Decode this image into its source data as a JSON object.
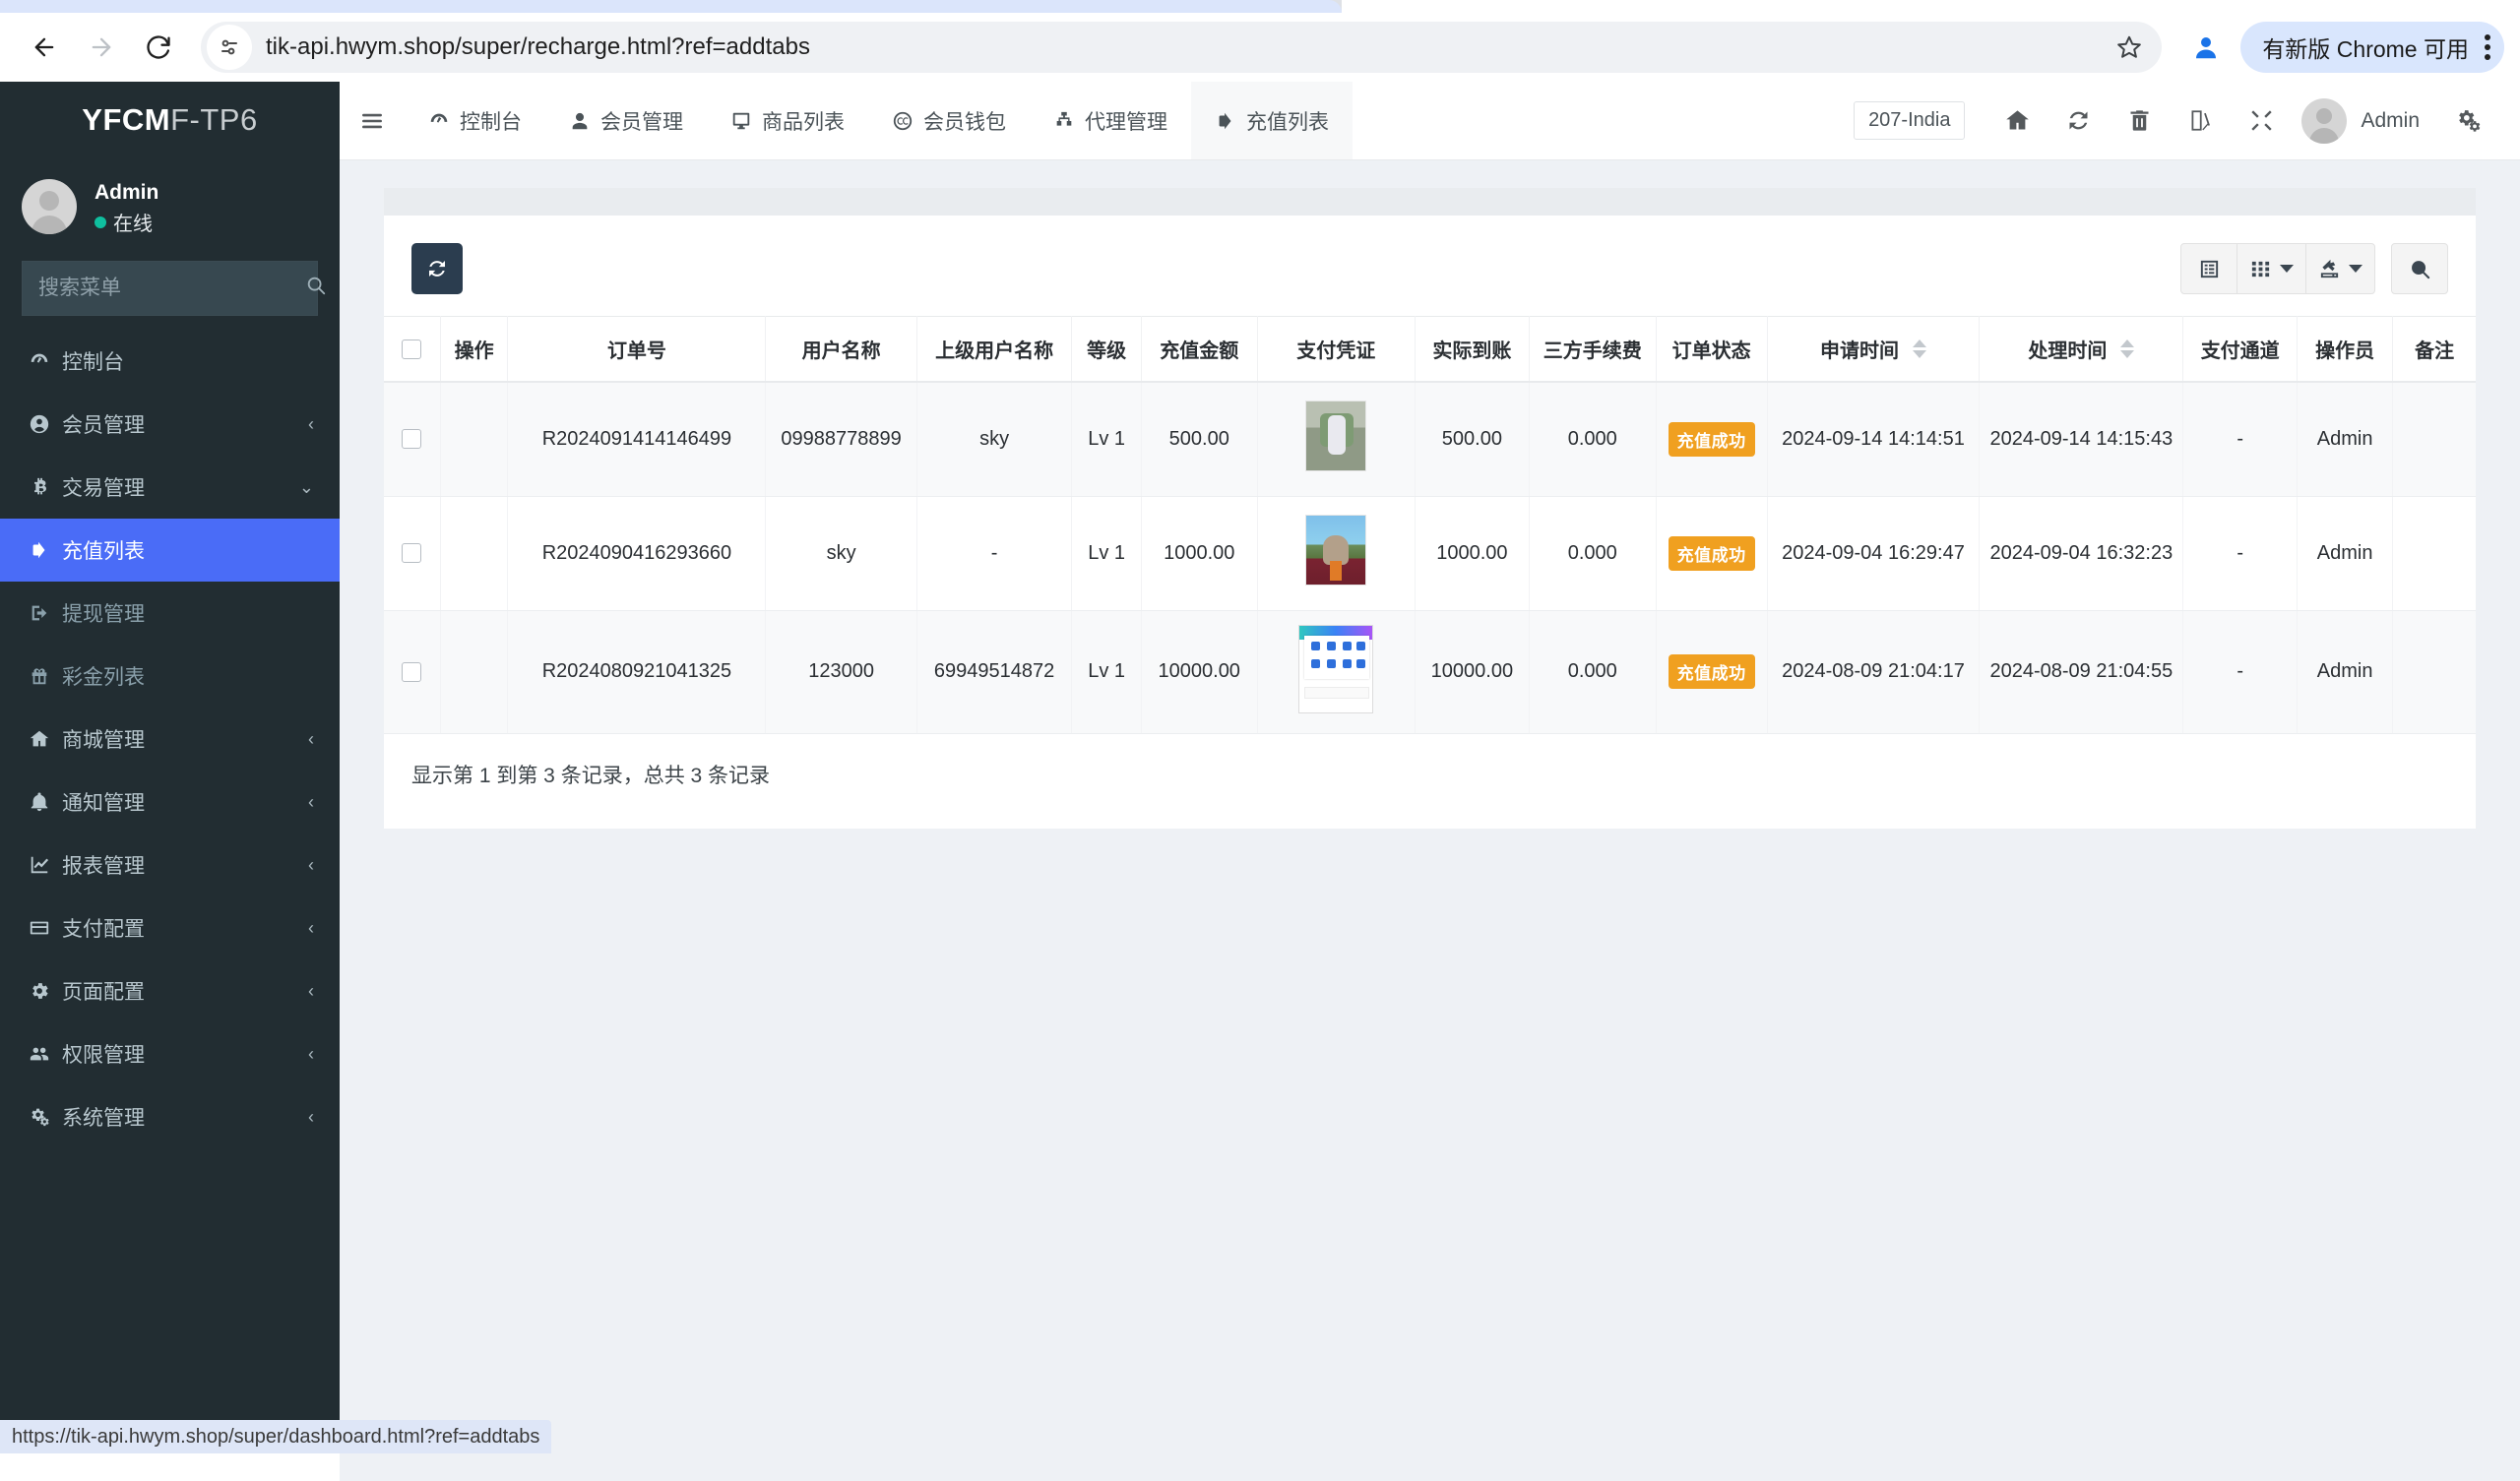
{
  "browser": {
    "url": "tik-api.hwym.shop/super/recharge.html?ref=addtabs",
    "back_icon": "back-arrow-icon",
    "forward_icon": "forward-arrow-icon",
    "reload_icon": "reload-icon",
    "site_info_icon": "site-settings-icon",
    "bookmark_icon": "star-icon",
    "profile_icon": "profile-avatar-icon",
    "update_label": "有新版 Chrome 可用",
    "menu_icon": "three-dot-menu-icon",
    "status_link": "https://tik-api.hwym.shop/super/dashboard.html?ref=addtabs"
  },
  "sidebar": {
    "brand_a": "YFCM",
    "brand_b": "F-TP6",
    "user": {
      "name": "Admin",
      "status": "在线"
    },
    "search_placeholder": "搜索菜单",
    "search_value": "",
    "search_icon": "search-icon",
    "items": [
      {
        "label": "控制台",
        "icon": "dashboard-icon",
        "caret": "",
        "state": "normal"
      },
      {
        "label": "会员管理",
        "icon": "user-circle-icon",
        "caret": "‹",
        "state": "normal"
      },
      {
        "label": "交易管理",
        "icon": "bitcoin-icon",
        "caret": "⌄",
        "state": "expanded"
      },
      {
        "label": "充值列表",
        "icon": "sign-in-icon",
        "caret": "",
        "state": "active"
      },
      {
        "label": "提现管理",
        "icon": "sign-out-icon",
        "caret": "",
        "state": "dim"
      },
      {
        "label": "彩金列表",
        "icon": "gift-icon",
        "caret": "",
        "state": "dim"
      },
      {
        "label": "商城管理",
        "icon": "home-icon",
        "caret": "‹",
        "state": "normal"
      },
      {
        "label": "通知管理",
        "icon": "bell-icon",
        "caret": "‹",
        "state": "normal"
      },
      {
        "label": "报表管理",
        "icon": "chart-line-icon",
        "caret": "‹",
        "state": "normal"
      },
      {
        "label": "支付配置",
        "icon": "credit-card-icon",
        "caret": "‹",
        "state": "normal"
      },
      {
        "label": "页面配置",
        "icon": "gear-icon",
        "caret": "‹",
        "state": "normal"
      },
      {
        "label": "权限管理",
        "icon": "users-icon",
        "caret": "‹",
        "state": "normal"
      },
      {
        "label": "系统管理",
        "icon": "gears-icon",
        "caret": "‹",
        "state": "normal"
      }
    ]
  },
  "topnav": {
    "hamburger_icon": "hamburger-menu-icon",
    "tabs": [
      {
        "label": "控制台",
        "icon": "dashboard-icon",
        "active": false
      },
      {
        "label": "会员管理",
        "icon": "user-icon",
        "active": false
      },
      {
        "label": "商品列表",
        "icon": "monitor-icon",
        "active": false
      },
      {
        "label": "会员钱包",
        "icon": "cc-icon",
        "active": false
      },
      {
        "label": "代理管理",
        "icon": "sitemap-icon",
        "active": false
      },
      {
        "label": "充值列表",
        "icon": "sign-in-icon",
        "active": true
      }
    ],
    "lang_badge": "207-India",
    "icons": [
      {
        "name": "home-icon"
      },
      {
        "name": "refresh-icon"
      },
      {
        "name": "trash-icon"
      },
      {
        "name": "language-switch-icon"
      },
      {
        "name": "fullscreen-icon"
      }
    ],
    "user_name": "Admin",
    "settings_icon": "gears-icon"
  },
  "toolbar": {
    "refresh_icon": "refresh-icon",
    "columns_list_icon": "list-view-icon",
    "columns_grid_icon": "grid-columns-icon",
    "export_icon": "export-icon",
    "search_icon": "search-icon"
  },
  "table": {
    "headers": [
      {
        "label": "",
        "key": "checkbox"
      },
      {
        "label": "操作",
        "key": "action"
      },
      {
        "label": "订单号",
        "key": "order_no"
      },
      {
        "label": "用户名称",
        "key": "username"
      },
      {
        "label": "上级用户名称",
        "key": "parent_username"
      },
      {
        "label": "等级",
        "key": "level"
      },
      {
        "label": "充值金额",
        "key": "recharge_amount"
      },
      {
        "label": "支付凭证",
        "key": "voucher"
      },
      {
        "label": "实际到账",
        "key": "actual_amount"
      },
      {
        "label": "三方手续费",
        "key": "third_party_fee"
      },
      {
        "label": "订单状态",
        "key": "order_status"
      },
      {
        "label": "申请时间",
        "key": "apply_time",
        "sortable": true
      },
      {
        "label": "处理时间",
        "key": "process_time",
        "sortable": true
      },
      {
        "label": "支付通道",
        "key": "pay_channel"
      },
      {
        "label": "操作员",
        "key": "operator"
      },
      {
        "label": "备注",
        "key": "remark"
      }
    ],
    "rows": [
      {
        "order_no": "R2024091414146499",
        "username": "09988778899",
        "parent_username": "sky",
        "level": "Lv 1",
        "recharge_amount": "500.00",
        "voucher": "photo-man-on-couch",
        "actual_amount": "500.00",
        "third_party_fee": "0.000",
        "order_status": "充值成功",
        "apply_time": "2024-09-14 14:14:51",
        "process_time": "2024-09-14 14:15:43",
        "pay_channel": "-",
        "operator": "Admin",
        "remark": ""
      },
      {
        "order_no": "R2024090416293660",
        "username": "sky",
        "parent_username": "-",
        "level": "Lv 1",
        "recharge_amount": "1000.00",
        "voucher": "photo-dog-in-car",
        "actual_amount": "1000.00",
        "third_party_fee": "0.000",
        "order_status": "充值成功",
        "apply_time": "2024-09-04 16:29:47",
        "process_time": "2024-09-04 16:32:23",
        "pay_channel": "-",
        "operator": "Admin",
        "remark": ""
      },
      {
        "order_no": "R2024080921041325",
        "username": "123000",
        "parent_username": "69949514872",
        "level": "Lv 1",
        "recharge_amount": "10000.00",
        "voucher": "screenshot-app-grid",
        "actual_amount": "10000.00",
        "third_party_fee": "0.000",
        "order_status": "充值成功",
        "apply_time": "2024-08-09 21:04:17",
        "process_time": "2024-08-09 21:04:55",
        "pay_channel": "-",
        "operator": "Admin",
        "remark": ""
      }
    ],
    "footer_text": "显示第 1 到第 3 条记录，总共 3 条记录"
  },
  "colors": {
    "sidebar_bg": "#222d32",
    "active_menu": "#4a6cf7",
    "badge_orange": "#f0a020",
    "content_bg": "#eef1f5",
    "online_green": "#0fbf9f"
  }
}
